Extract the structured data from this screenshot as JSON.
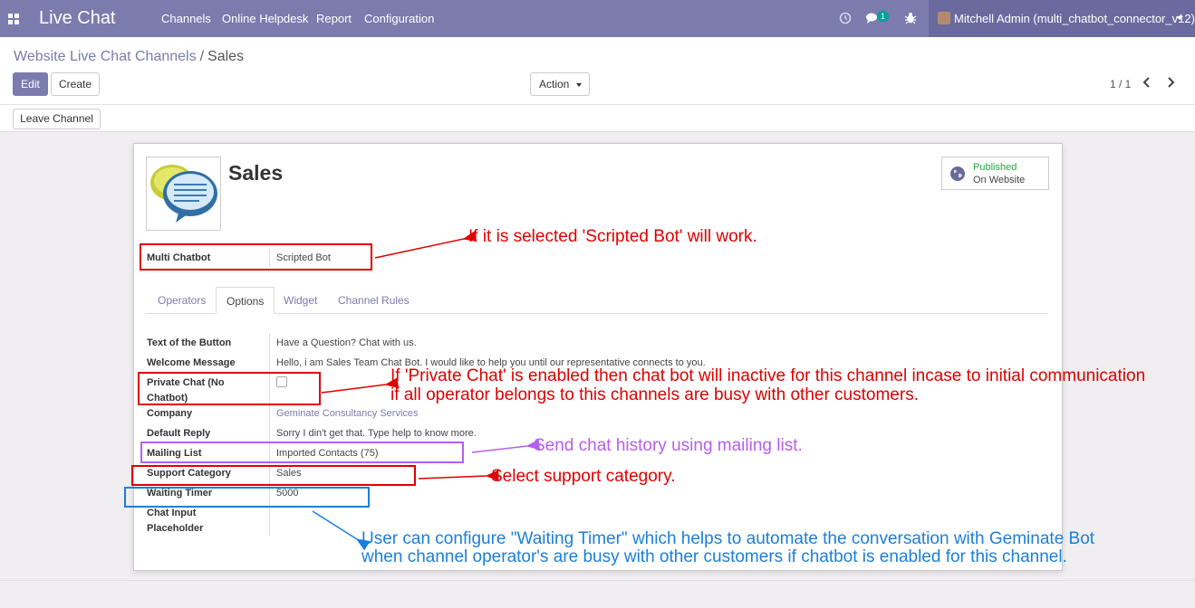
{
  "navbar": {
    "app_title": "Live Chat",
    "menu": [
      "Channels",
      "Online Helpdesk",
      "Report",
      "Configuration"
    ],
    "message_count": "1",
    "user": "Mitchell Admin (multi_chatbot_connector_v12)",
    "icons": [
      "apps-grid-icon",
      "clock-icon",
      "chat-bubbles-icon",
      "bug-icon",
      "user-avatar",
      "caret-down-icon"
    ],
    "colors": {
      "navbar": "#7c7bad",
      "user_area": "#6b6a9f",
      "badge": "#00a09d"
    }
  },
  "breadcrumb": {
    "parent": "Website Live Chat Channels",
    "separator": "/",
    "current": "Sales"
  },
  "buttons": {
    "edit": "Edit",
    "create": "Create",
    "action": "Action",
    "leave_channel": "Leave Channel"
  },
  "pager": {
    "value": "1 / 1"
  },
  "record": {
    "title": "Sales",
    "published_status": "Published",
    "published_target": "On Website",
    "multi_chatbot_label": "Multi Chatbot",
    "multi_chatbot_value": "Scripted Bot"
  },
  "tabs": [
    "Operators",
    "Options",
    "Widget",
    "Channel Rules"
  ],
  "active_tab": "Options",
  "fields": {
    "button_text": {
      "label": "Text of the Button",
      "value": "Have a Question? Chat with us."
    },
    "welcome": {
      "label": "Welcome Message",
      "value": "Hello, i am Sales Team Chat Bot. I would like to help you until our representative connects to you."
    },
    "private_chat": {
      "label_1": "Private Chat (No",
      "label_2": "Chatbot)",
      "checked": false
    },
    "company": {
      "label": "Company",
      "value": "Geminate Consultancy Services"
    },
    "default_reply": {
      "label": "Default Reply",
      "value": "Sorry I din't get that. Type help to know more."
    },
    "mailing_list": {
      "label": "Mailing List",
      "value": "Imported Contacts (75)"
    },
    "support_category": {
      "label": "Support Category",
      "value": "Sales"
    },
    "waiting_timer": {
      "label": "Waiting Timer",
      "value": "5000"
    },
    "input_placeholder": {
      "label_1": "Chat Input",
      "label_2": "Placeholder",
      "value": ""
    }
  },
  "annotations": {
    "scripted_bot": "If it is selected 'Scripted Bot' will work.",
    "private_chat_1": "If 'Private Chat' is enabled then chat bot will inactive for this channel incase to initial communication",
    "private_chat_2": "if all operator belongs to this channels are busy with other customers.",
    "mailing_list": "Send chat history using mailing list.",
    "support_category": "Select support category.",
    "waiting_timer_1": "User can configure \"Waiting Timer\" which helps to automate the conversation with Geminate Bot",
    "waiting_timer_2": "when channel operator's are busy with other customers if chatbot is enabled for this channel.",
    "colors": {
      "red": "#e00000",
      "purple": "#b65ef0",
      "blue": "#1a7fdc"
    }
  }
}
